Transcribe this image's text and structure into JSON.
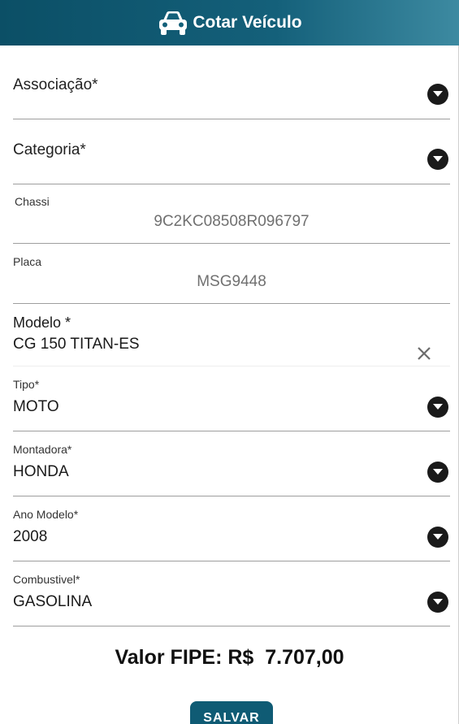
{
  "header": {
    "title": "Cotar Veículo",
    "icon": "car-icon"
  },
  "form": {
    "associacao": {
      "label": "Associação*"
    },
    "categoria": {
      "label": "Categoria*"
    },
    "chassi": {
      "label": "Chassi",
      "value": "9C2KC08508R096797"
    },
    "placa": {
      "label": "Placa",
      "value": "MSG9448"
    },
    "modelo": {
      "label": "Modelo *",
      "value": "CG 150 TITAN-ES"
    },
    "tipo": {
      "label": "Tipo*",
      "value": "MOTO"
    },
    "montadora": {
      "label": "Montadora*",
      "value": "HONDA"
    },
    "ano_modelo": {
      "label": "Ano Modelo*",
      "value": "2008"
    },
    "combustivel": {
      "label": "Combustivel*",
      "value": "GASOLINA"
    }
  },
  "fipe": {
    "text": "Valor FIPE: R$  7.707,00"
  },
  "actions": {
    "save_label": "SALVAR"
  },
  "colors": {
    "header": "#0b4f66",
    "button": "#0f5b74",
    "dropdown_icon": "#1a1a1a"
  }
}
